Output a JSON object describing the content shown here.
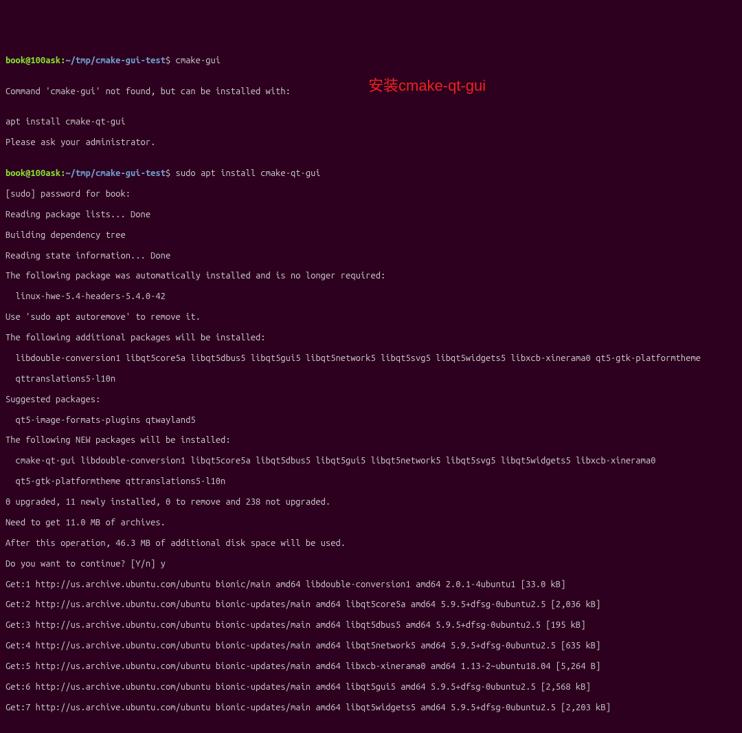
{
  "annotation": "安装cmake-qt-gui",
  "prompt1": {
    "user": "book@100ask",
    "sep": ":",
    "path": "~/tmp/cmake-gui-test",
    "dollar": "$ ",
    "command": "cmake-gui"
  },
  "block1": [
    "",
    "Command 'cmake-gui' not found, but can be installed with:",
    "",
    "apt install cmake-qt-gui",
    "Please ask your administrator.",
    ""
  ],
  "prompt2": {
    "user": "book@100ask",
    "sep": ":",
    "path": "~/tmp/cmake-gui-test",
    "dollar": "$ ",
    "command": "sudo apt install cmake-qt-gui"
  },
  "block2": [
    "[sudo] password for book: ",
    "Reading package lists... Done",
    "Building dependency tree       ",
    "Reading state information... Done",
    "The following package was automatically installed and is no longer required:",
    "  linux-hwe-5.4-headers-5.4.0-42",
    "Use 'sudo apt autoremove' to remove it.",
    "The following additional packages will be installed:",
    "  libdouble-conversion1 libqt5core5a libqt5dbus5 libqt5gui5 libqt5network5 libqt5svg5 libqt5widgets5 libxcb-xinerama0 qt5-gtk-platformtheme",
    "  qttranslations5-l10n",
    "Suggested packages:",
    "  qt5-image-formats-plugins qtwayland5",
    "The following NEW packages will be installed:",
    "  cmake-qt-gui libdouble-conversion1 libqt5core5a libqt5dbus5 libqt5gui5 libqt5network5 libqt5svg5 libqt5widgets5 libxcb-xinerama0",
    "  qt5-gtk-platformtheme qttranslations5-l10n",
    "0 upgraded, 11 newly installed, 0 to remove and 238 not upgraded.",
    "Need to get 11.0 MB of archives.",
    "After this operation, 46.3 MB of additional disk space will be used.",
    "Do you want to continue? [Y/n] y",
    "Get:1 http://us.archive.ubuntu.com/ubuntu bionic/main amd64 libdouble-conversion1 amd64 2.0.1-4ubuntu1 [33.0 kB]",
    "Get:2 http://us.archive.ubuntu.com/ubuntu bionic-updates/main amd64 libqt5core5a amd64 5.9.5+dfsg-0ubuntu2.5 [2,036 kB]",
    "Get:3 http://us.archive.ubuntu.com/ubuntu bionic-updates/main amd64 libqt5dbus5 amd64 5.9.5+dfsg-0ubuntu2.5 [195 kB]",
    "Get:4 http://us.archive.ubuntu.com/ubuntu bionic-updates/main amd64 libqt5network5 amd64 5.9.5+dfsg-0ubuntu2.5 [635 kB]",
    "Get:5 http://us.archive.ubuntu.com/ubuntu bionic-updates/main amd64 libxcb-xinerama0 amd64 1.13-2~ubuntu18.04 [5,264 B]",
    "Get:6 http://us.archive.ubuntu.com/ubuntu bionic-updates/main amd64 libqt5gui5 amd64 5.9.5+dfsg-0ubuntu2.5 [2,568 kB]",
    "Get:7 http://us.archive.ubuntu.com/ubuntu bionic-updates/main amd64 libqt5widgets5 amd64 5.9.5+dfsg-0ubuntu2.5 [2,203 kB]"
  ]
}
